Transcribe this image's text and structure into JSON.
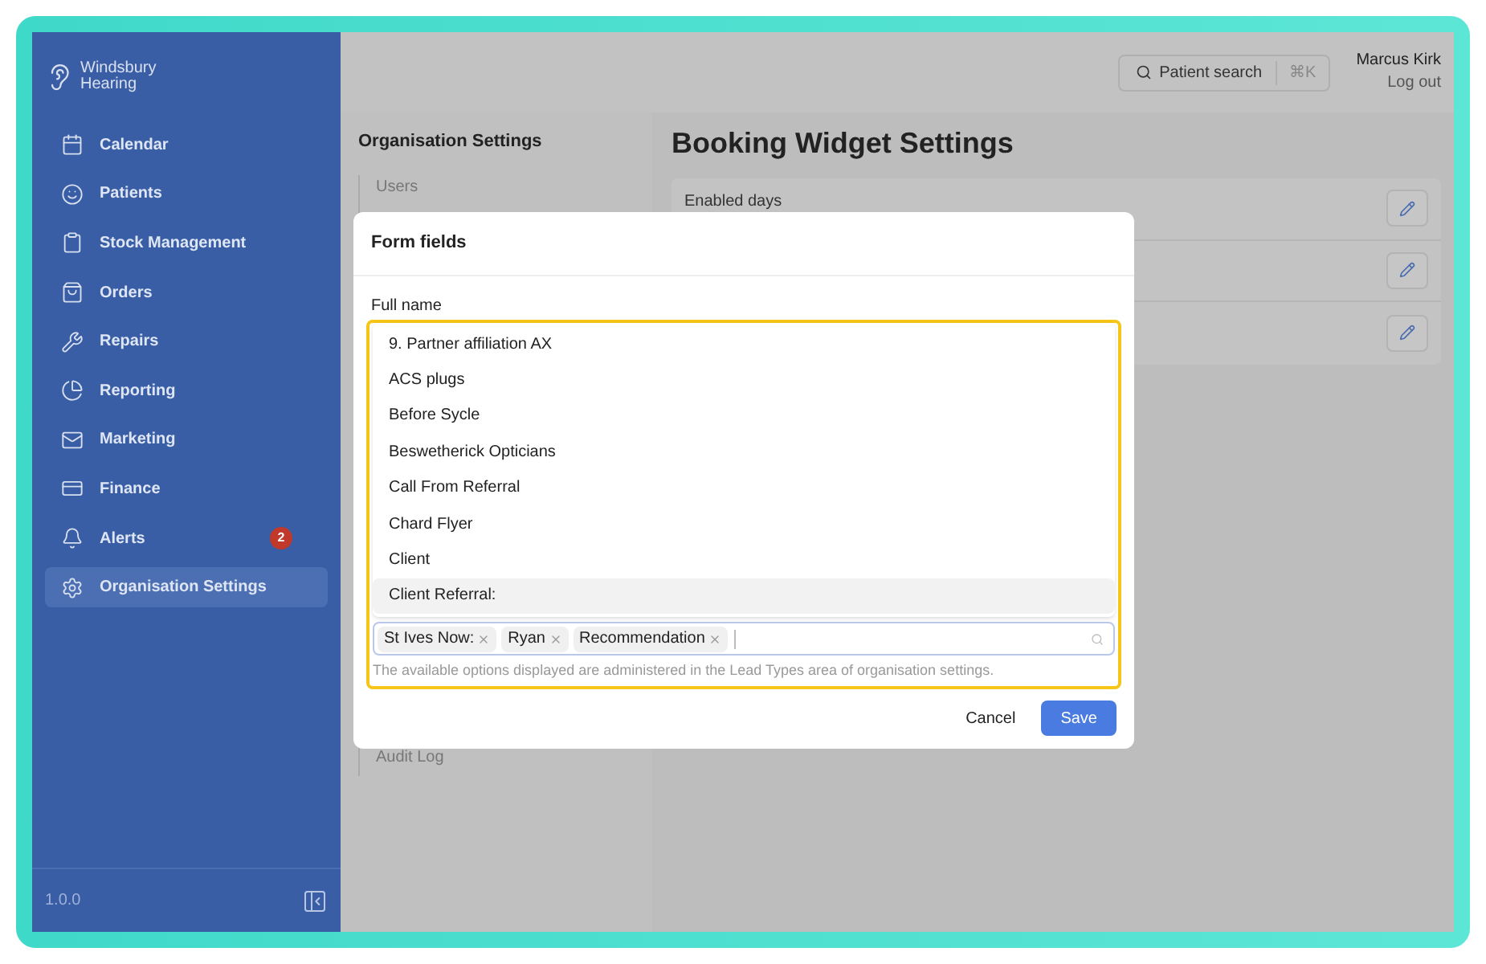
{
  "brand": {
    "name": "Windsbury",
    "sub": "Hearing"
  },
  "sidebar": {
    "items": [
      {
        "label": "Calendar",
        "selected": false
      },
      {
        "label": "Patients",
        "selected": false
      },
      {
        "label": "Stock Management",
        "selected": false
      },
      {
        "label": "Orders",
        "selected": false
      },
      {
        "label": "Repairs",
        "selected": false
      },
      {
        "label": "Reporting",
        "selected": false
      },
      {
        "label": "Marketing",
        "selected": false
      },
      {
        "label": "Finance",
        "selected": false
      },
      {
        "label": "Alerts",
        "selected": false,
        "badge": "2"
      },
      {
        "label": "Organisation Settings",
        "selected": true
      }
    ],
    "version": "1.0.0"
  },
  "header": {
    "search_label": "Patient search",
    "shortcut": "⌘K",
    "user": "Marcus Kirk",
    "logout": "Log out"
  },
  "settings_nav": {
    "title": "Organisation Settings",
    "items": [
      "Users",
      "Audit Log"
    ]
  },
  "content": {
    "title": "Booking Widget Settings",
    "rows": [
      {
        "label": "Enabled days"
      },
      {},
      {}
    ]
  },
  "modal": {
    "title": "Form fields",
    "field_label": "Full name",
    "options": [
      {
        "label": "9. Partner affiliation AX",
        "selected": false
      },
      {
        "label": "ACS plugs",
        "selected": false
      },
      {
        "label": "Before Sycle",
        "selected": false
      },
      {
        "label": "Beswetherick Opticians",
        "selected": false
      },
      {
        "label": "Call From Referral",
        "selected": false
      },
      {
        "label": "Chard Flyer",
        "selected": false
      },
      {
        "label": "Client",
        "selected": false
      },
      {
        "label": "Client Referral:",
        "selected": true
      }
    ],
    "tags": [
      "St Ives Now:",
      "Ryan",
      "Recommendation"
    ],
    "help": "The available options displayed are administered in the Lead Types area of organisation settings.",
    "cancel": "Cancel",
    "save": "Save"
  }
}
